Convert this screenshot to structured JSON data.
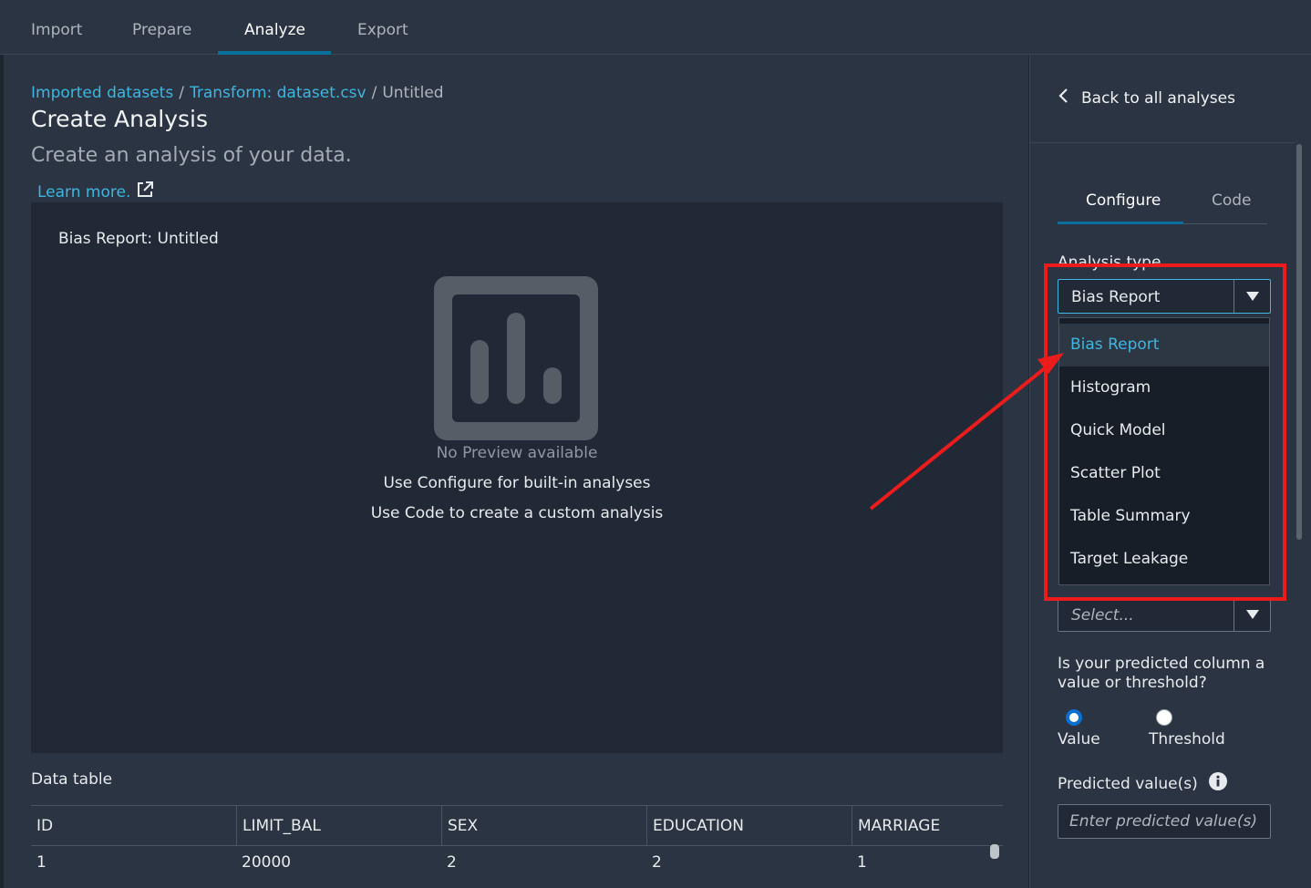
{
  "top_tabs": [
    {
      "label": "Import"
    },
    {
      "label": "Prepare"
    },
    {
      "label": "Analyze"
    },
    {
      "label": "Export"
    }
  ],
  "breadcrumb": {
    "items": [
      "Imported datasets",
      "Transform: dataset.csv",
      "Untitled"
    ],
    "separator": "/"
  },
  "page": {
    "title": "Create Analysis",
    "subtitle": "Create an analysis of your data.",
    "learn_more": "Learn more."
  },
  "preview": {
    "title": "Bias Report: Untitled",
    "no_preview": "No Preview available",
    "hint_configure": "Use Configure for built-in analyses",
    "hint_code": "Use Code to create a custom analysis"
  },
  "data_table": {
    "label": "Data table",
    "columns": [
      "ID",
      "LIMIT_BAL",
      "SEX",
      "EDUCATION",
      "MARRIAGE"
    ],
    "rows": [
      [
        "1",
        "20000",
        "2",
        "2",
        "1"
      ]
    ]
  },
  "panel": {
    "back_label": "Back to all analyses",
    "tabs": [
      {
        "label": "Configure"
      },
      {
        "label": "Code"
      }
    ],
    "analysis_type_label": "Analysis type",
    "analysis_type_value": "Bias Report",
    "analysis_options": [
      "Bias Report",
      "Histogram",
      "Quick Model",
      "Scatter Plot",
      "Table Summary",
      "Target Leakage"
    ],
    "second_select_placeholder": "Select...",
    "predicted_question": "Is your predicted column a value or threshold?",
    "radio_value": "Value",
    "radio_threshold": "Threshold",
    "predicted_values_label": "Predicted value(s)",
    "predicted_values_placeholder": "Enter predicted value(s)"
  },
  "colors": {
    "background": "#2a3442",
    "accent_link": "#3fb6df",
    "tab_underline": "#0a6f9a",
    "annotation": "#ec1c1c"
  }
}
